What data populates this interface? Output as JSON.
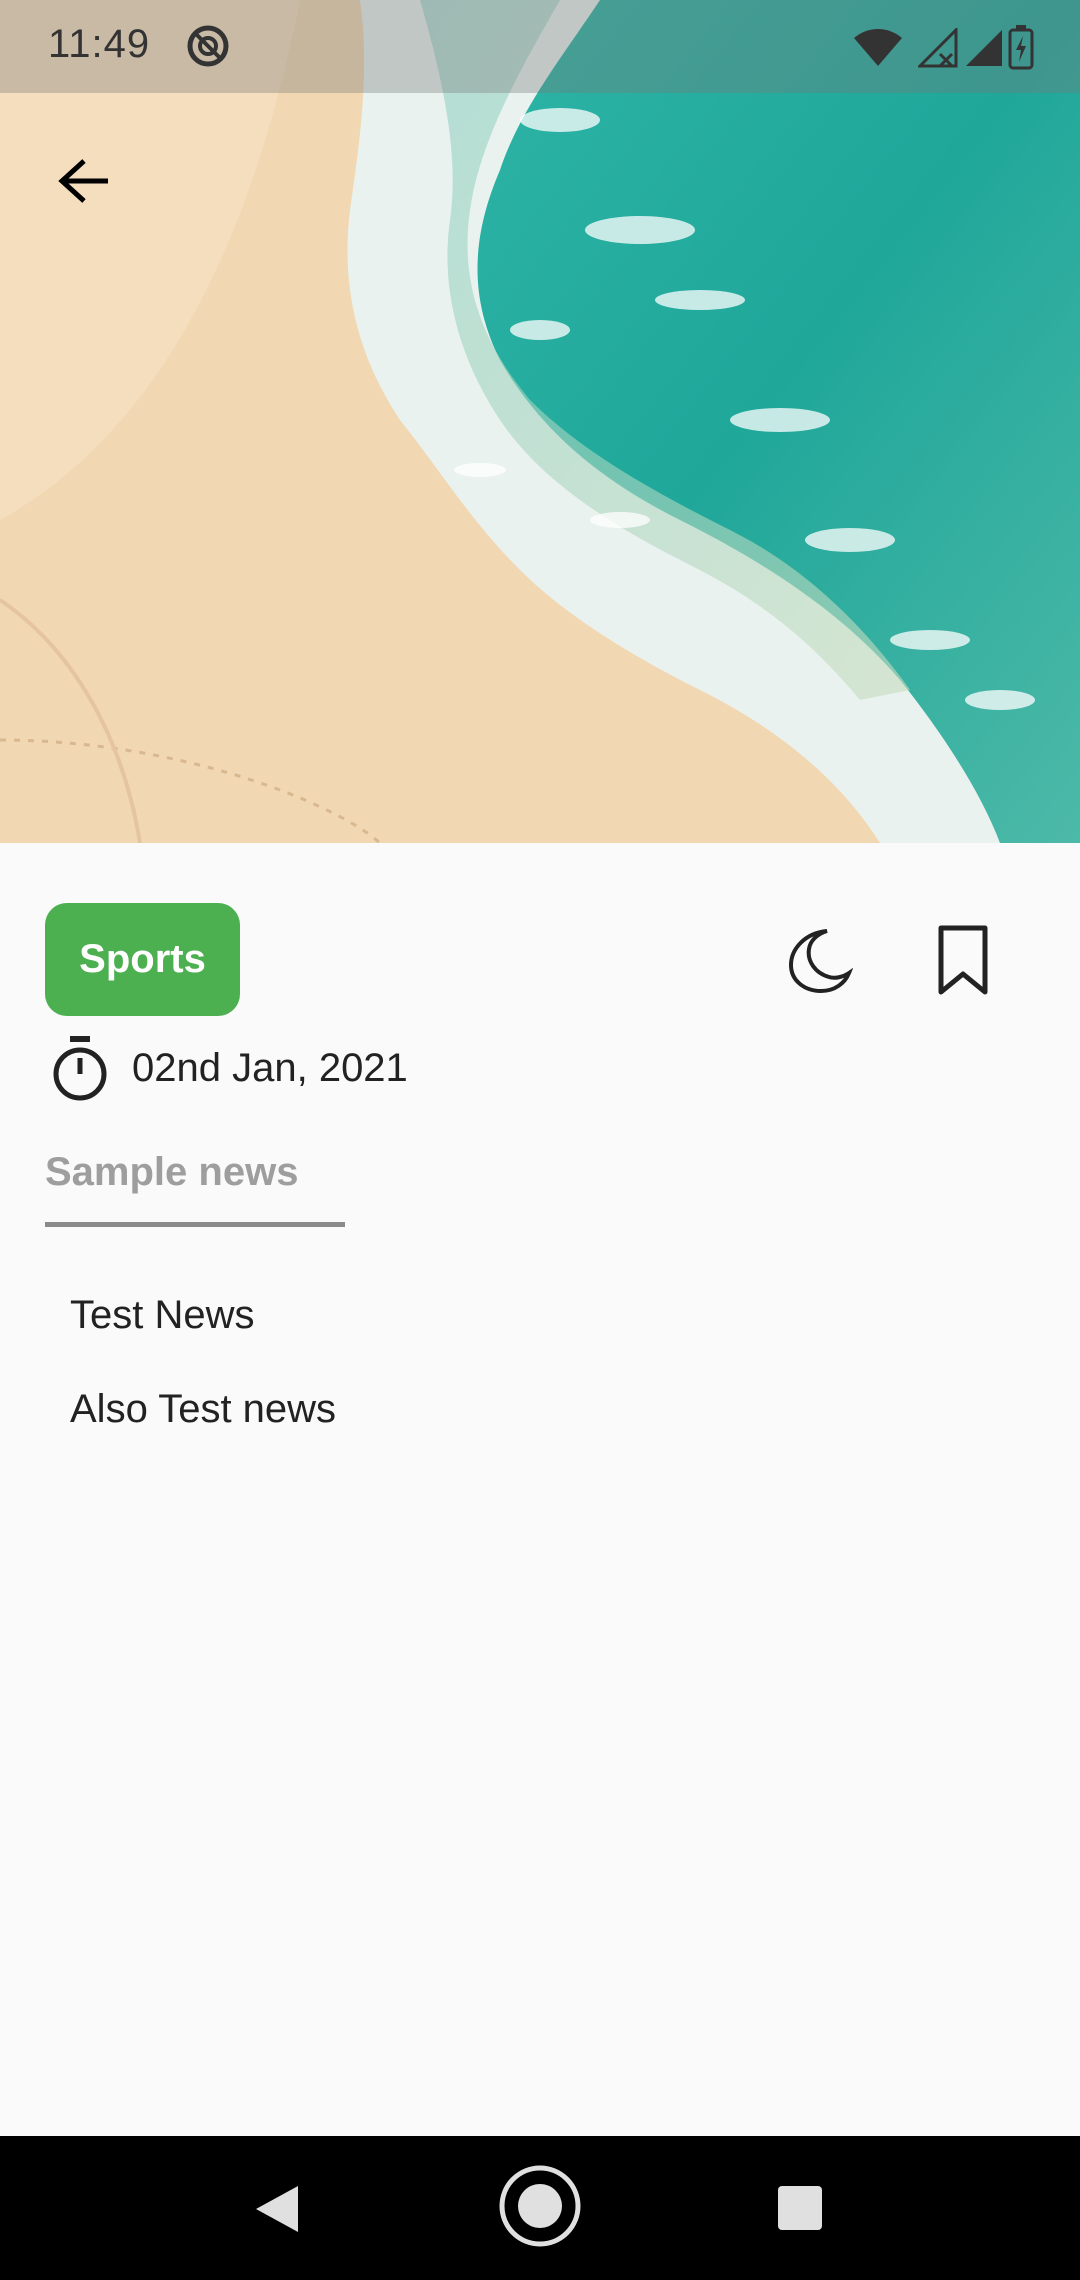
{
  "status_bar": {
    "time": "11:49",
    "icons": [
      "no-disturb-icon",
      "wifi-icon",
      "signal-off-icon",
      "signal-icon",
      "battery-charging-icon"
    ]
  },
  "hero": {
    "image": "beach-aerial-photo",
    "back_icon": "arrow-back-icon"
  },
  "article": {
    "category": "Sports",
    "category_color": "#4caf50",
    "date": "02nd Jan, 2021",
    "date_icon": "stopwatch-icon",
    "actions": [
      {
        "name": "dark-mode",
        "icon": "moon-icon"
      },
      {
        "name": "bookmark",
        "icon": "bookmark-icon"
      }
    ],
    "section_tab": "Sample news",
    "items": [
      "Test News",
      "Also Test news"
    ]
  },
  "nav_bar": {
    "buttons": [
      "back-triangle-icon",
      "home-circle-icon",
      "recents-square-icon"
    ]
  }
}
